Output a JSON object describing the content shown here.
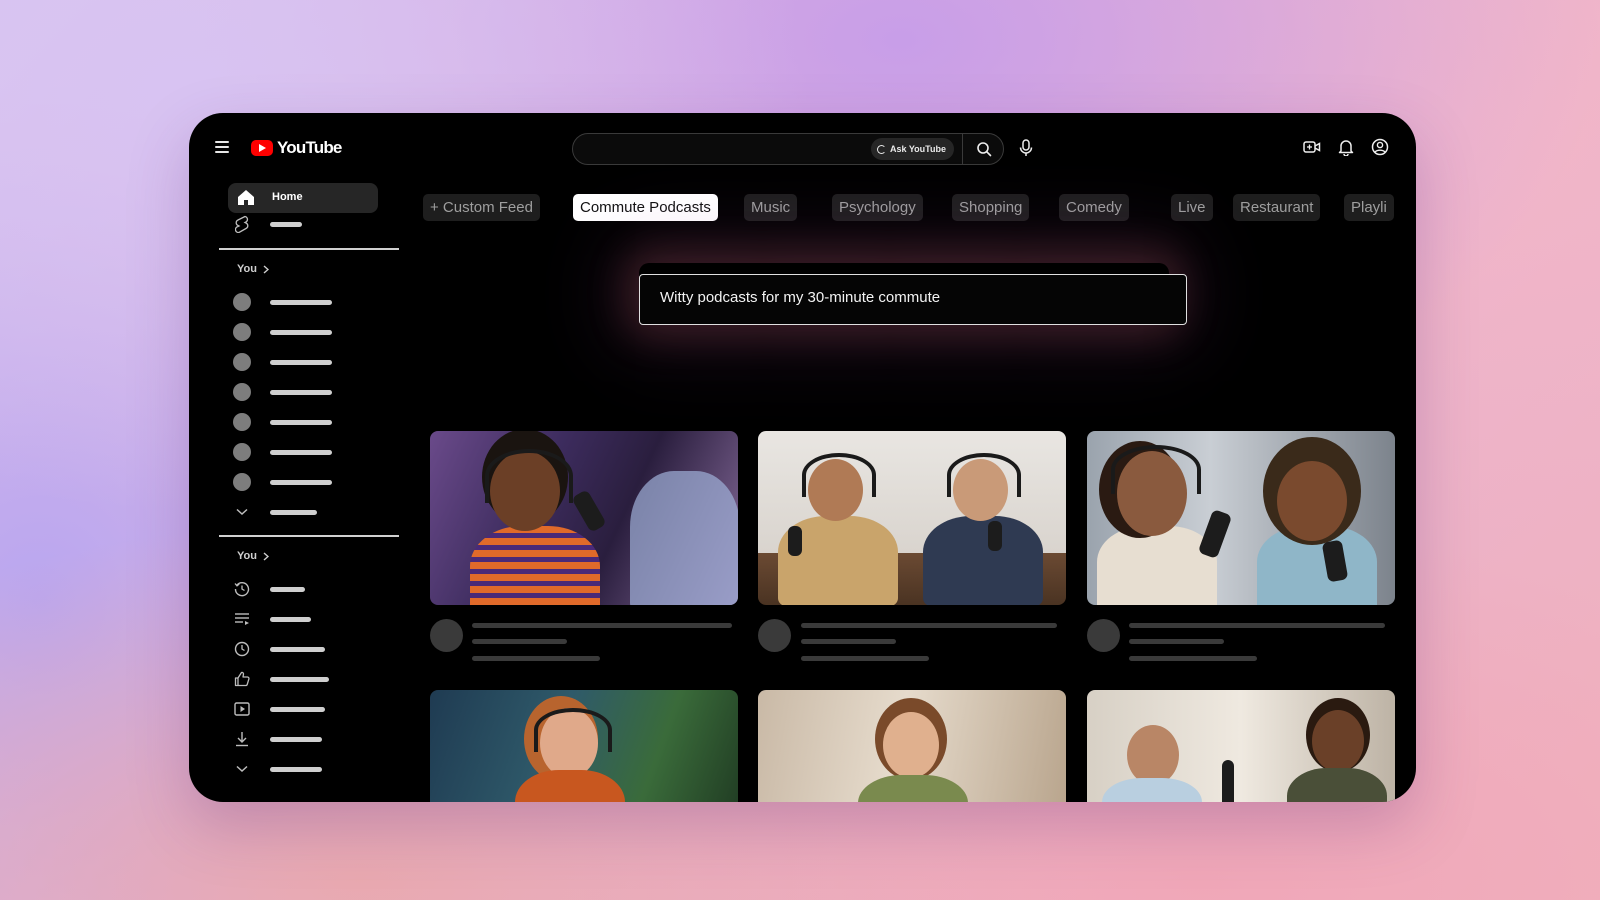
{
  "app": {
    "logo_text": "YouTube"
  },
  "header": {
    "search_placeholder": "",
    "ask_label": "Ask YouTube"
  },
  "sidebar": {
    "home_label": "Home",
    "section1_label": "You",
    "section2_label": "You"
  },
  "chips": [
    {
      "label": "+ Custom Feed"
    },
    {
      "label": "Commute Podcasts",
      "active": true
    },
    {
      "label": "Music"
    },
    {
      "label": "Psychology"
    },
    {
      "label": "Shopping"
    },
    {
      "label": "Comedy"
    },
    {
      "label": "Live"
    },
    {
      "label": "Restaurant"
    },
    {
      "label": "Playli"
    }
  ],
  "prompt": {
    "text": "Witty podcasts for my 30-minute commute"
  },
  "colors": {
    "brand_red": "#ff0000",
    "background": "#000000",
    "chip_active": "#ffffff"
  }
}
